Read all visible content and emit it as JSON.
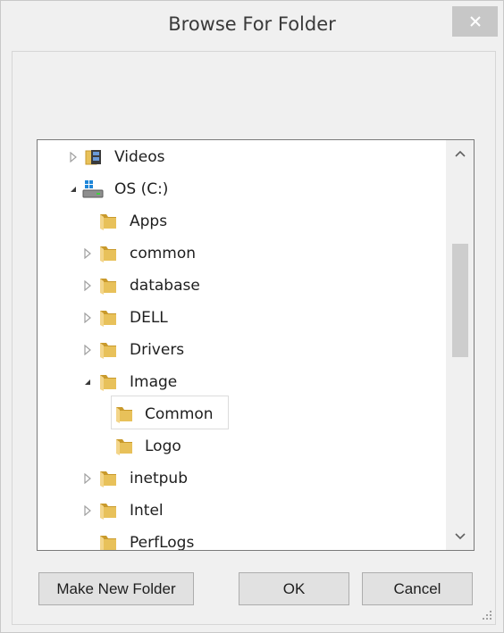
{
  "window": {
    "title": "Browse For Folder"
  },
  "tree": {
    "items": [
      {
        "label": "Videos",
        "icon": "videos-library-icon",
        "expander": "collapsed"
      },
      {
        "label": "OS (C:)",
        "icon": "drive-icon",
        "expander": "expanded"
      },
      {
        "label": "Apps",
        "icon": "folder-icon",
        "expander": "none"
      },
      {
        "label": "common",
        "icon": "folder-icon",
        "expander": "collapsed"
      },
      {
        "label": "database",
        "icon": "folder-icon",
        "expander": "collapsed"
      },
      {
        "label": "DELL",
        "icon": "folder-icon",
        "expander": "collapsed"
      },
      {
        "label": "Drivers",
        "icon": "folder-icon",
        "expander": "collapsed"
      },
      {
        "label": "Image",
        "icon": "folder-icon",
        "expander": "expanded"
      },
      {
        "label": "Common",
        "icon": "folder-icon",
        "expander": "none",
        "selected": true
      },
      {
        "label": "Logo",
        "icon": "folder-icon",
        "expander": "none"
      },
      {
        "label": "inetpub",
        "icon": "folder-icon",
        "expander": "collapsed"
      },
      {
        "label": "Intel",
        "icon": "folder-icon",
        "expander": "collapsed"
      },
      {
        "label": "PerfLogs",
        "icon": "folder-icon",
        "expander": "none"
      }
    ]
  },
  "buttons": {
    "make_new_folder": "Make New Folder",
    "ok": "OK",
    "cancel": "Cancel"
  },
  "colors": {
    "folder": "#e8c15a",
    "folder_dark": "#c99a2c",
    "background": "#f0f0f0"
  }
}
